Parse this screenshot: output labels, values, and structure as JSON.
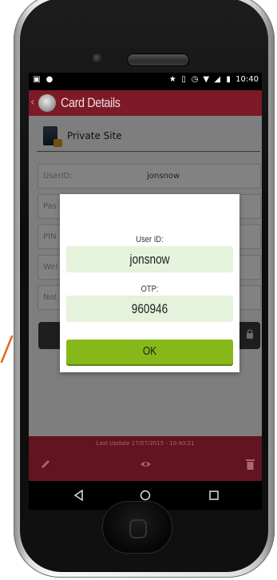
{
  "status_bar": {
    "time": "10:40",
    "left_icons": [
      "image-notification-icon",
      "android-notification-icon"
    ],
    "right_icons": [
      "star-icon",
      "vibrate-icon",
      "alarm-icon",
      "wifi-icon",
      "signal-icon",
      "battery-icon"
    ]
  },
  "app_bar": {
    "title": "Card Details"
  },
  "card": {
    "site_name": "Private Site",
    "fields": [
      {
        "label": "UserID:",
        "value": "jonsnow"
      },
      {
        "label": "Pas",
        "value": ""
      },
      {
        "label": "PIN",
        "value": ""
      },
      {
        "label": "Wel",
        "value": ""
      },
      {
        "label": "Not",
        "value": ""
      }
    ]
  },
  "dialog": {
    "user_id_label": "User ID:",
    "user_id_value": "jonsnow",
    "otp_label": "OTP:",
    "otp_value": "960946",
    "ok_label": "OK"
  },
  "bottom_bar": {
    "last_update": "Last Update 17/07/2015 - 10:40:21"
  },
  "colors": {
    "app_bar": "#7d1a28",
    "bottom_bar": "#621420",
    "ok_button": "#86b819",
    "dialog_box": "#e6f3dc"
  }
}
